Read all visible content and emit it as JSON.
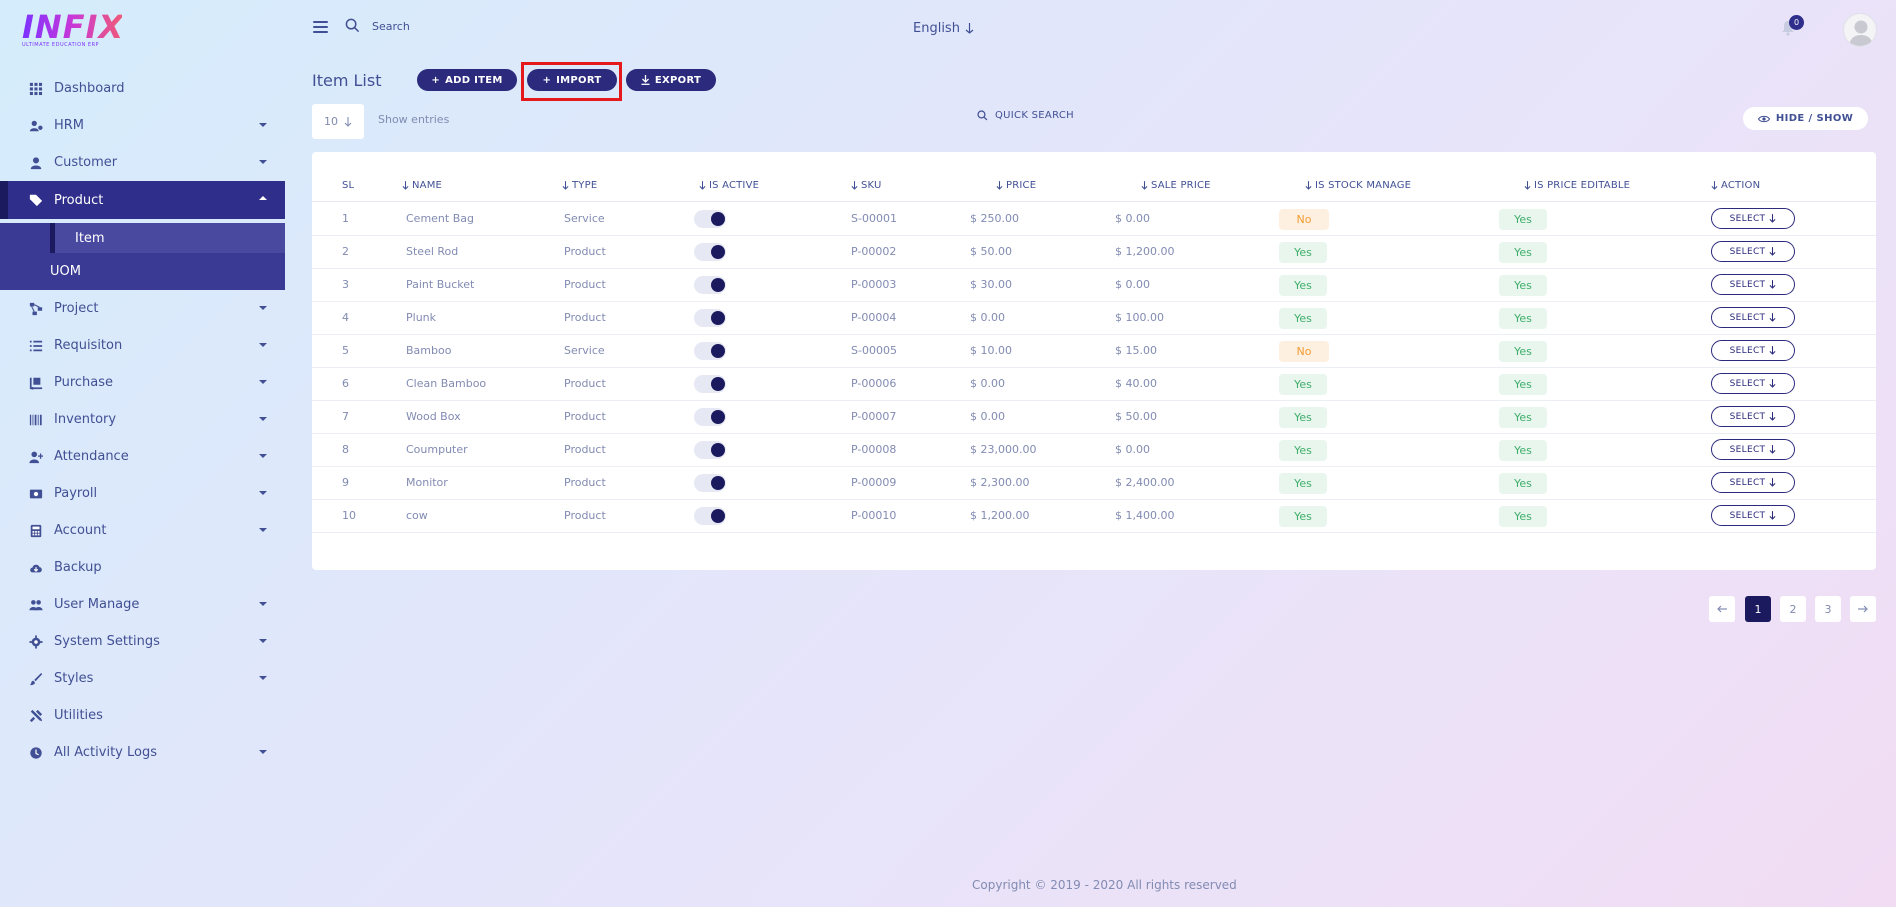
{
  "logo": {
    "brand": "INFIX",
    "tagline": "ULTIMATE EDUCATION ERP"
  },
  "sidebar": {
    "items": [
      {
        "label": "Dashboard",
        "icon": "grid-icon",
        "has_caret": false
      },
      {
        "label": "HRM",
        "icon": "users-cog-icon",
        "has_caret": true
      },
      {
        "label": "Customer",
        "icon": "user-icon",
        "has_caret": true
      },
      {
        "label": "Product",
        "icon": "tags-icon",
        "has_caret": true,
        "active": true
      },
      {
        "label": "Project",
        "icon": "project-diagram-icon",
        "has_caret": true
      },
      {
        "label": "Requisiton",
        "icon": "list-icon",
        "has_caret": true
      },
      {
        "label": "Purchase",
        "icon": "dolly-icon",
        "has_caret": true
      },
      {
        "label": "Inventory",
        "icon": "barcode-icon",
        "has_caret": true
      },
      {
        "label": "Attendance",
        "icon": "user-plus-icon",
        "has_caret": true
      },
      {
        "label": "Payroll",
        "icon": "money-icon",
        "has_caret": true
      },
      {
        "label": "Account",
        "icon": "calculator-icon",
        "has_caret": true
      },
      {
        "label": "Backup",
        "icon": "cloud-download-icon",
        "has_caret": false
      },
      {
        "label": "User Manage",
        "icon": "users-icon",
        "has_caret": true
      },
      {
        "label": "System Settings",
        "icon": "gear-icon",
        "has_caret": true
      },
      {
        "label": "Styles",
        "icon": "paint-brush-icon",
        "has_caret": true
      },
      {
        "label": "Utilities",
        "icon": "tools-icon",
        "has_caret": false
      },
      {
        "label": "All Activity Logs",
        "icon": "clock-icon",
        "has_caret": true
      }
    ],
    "product_sub": [
      {
        "label": "Item"
      },
      {
        "label": "UOM"
      }
    ]
  },
  "header": {
    "search_label": "Search",
    "language": "English",
    "notification_count": "0"
  },
  "toolbar": {
    "title": "Item List",
    "add_label": "ADD ITEM",
    "import_label": "IMPORT",
    "export_label": "EXPORT",
    "entries_value": "10",
    "entries_label": "Show entries",
    "quick_search": "QUICK SEARCH",
    "hide_show": "HIDE / SHOW"
  },
  "table": {
    "headers": [
      "SL",
      "NAME",
      "TYPE",
      "IS ACTIVE",
      "SKU",
      "PRICE",
      "SALE PRICE",
      "IS STOCK MANAGE",
      "IS PRICE EDITABLE",
      "ACTION"
    ],
    "select_label": "SELECT",
    "rows": [
      {
        "sl": "1",
        "name": "Cement Bag",
        "type": "Service",
        "sku": "S-00001",
        "price": "$ 250.00",
        "sale": "$ 0.00",
        "stock": "No",
        "editable": "Yes"
      },
      {
        "sl": "2",
        "name": "Steel Rod",
        "type": "Product",
        "sku": "P-00002",
        "price": "$ 50.00",
        "sale": "$ 1,200.00",
        "stock": "Yes",
        "editable": "Yes"
      },
      {
        "sl": "3",
        "name": "Paint Bucket",
        "type": "Product",
        "sku": "P-00003",
        "price": "$ 30.00",
        "sale": "$ 0.00",
        "stock": "Yes",
        "editable": "Yes"
      },
      {
        "sl": "4",
        "name": "Plunk",
        "type": "Product",
        "sku": "P-00004",
        "price": "$ 0.00",
        "sale": "$ 100.00",
        "stock": "Yes",
        "editable": "Yes"
      },
      {
        "sl": "5",
        "name": "Bamboo",
        "type": "Service",
        "sku": "S-00005",
        "price": "$ 10.00",
        "sale": "$ 15.00",
        "stock": "No",
        "editable": "Yes"
      },
      {
        "sl": "6",
        "name": "Clean Bamboo",
        "type": "Product",
        "sku": "P-00006",
        "price": "$ 0.00",
        "sale": "$ 40.00",
        "stock": "Yes",
        "editable": "Yes"
      },
      {
        "sl": "7",
        "name": "Wood Box",
        "type": "Product",
        "sku": "P-00007",
        "price": "$ 0.00",
        "sale": "$ 50.00",
        "stock": "Yes",
        "editable": "Yes"
      },
      {
        "sl": "8",
        "name": "Coumputer",
        "type": "Product",
        "sku": "P-00008",
        "price": "$ 23,000.00",
        "sale": "$ 0.00",
        "stock": "Yes",
        "editable": "Yes"
      },
      {
        "sl": "9",
        "name": "Monitor",
        "type": "Product",
        "sku": "P-00009",
        "price": "$ 2,300.00",
        "sale": "$ 2,400.00",
        "stock": "Yes",
        "editable": "Yes"
      },
      {
        "sl": "10",
        "name": "cow",
        "type": "Product",
        "sku": "P-00010",
        "price": "$ 1,200.00",
        "sale": "$ 1,400.00",
        "stock": "Yes",
        "editable": "Yes"
      }
    ]
  },
  "pagination": {
    "pages": [
      "1",
      "2",
      "3"
    ],
    "current": "1"
  },
  "footer": {
    "text": "Copyright © 2019 - 2020 All rights reserved"
  },
  "colors": {
    "accent": "#1b1a5e",
    "highlight": "#e5181b",
    "text": "#415094"
  }
}
